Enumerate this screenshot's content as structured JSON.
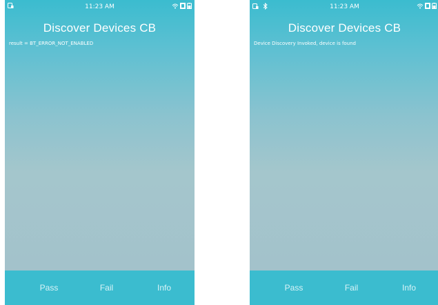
{
  "screens": [
    {
      "status": {
        "time": "11:23 AM",
        "left_icons": [
          "usb-icon"
        ],
        "right_icons": [
          "wifi-icon",
          "signal-icon",
          "battery-icon"
        ]
      },
      "title": "Discover Devices CB",
      "message": "result = BT_ERROR_NOT_ENABLED",
      "buttons": {
        "pass": "Pass",
        "fail": "Fail",
        "info": "Info"
      }
    },
    {
      "status": {
        "time": "11:23 AM",
        "left_icons": [
          "usb-icon",
          "bluetooth-icon"
        ],
        "right_icons": [
          "wifi-icon",
          "signal-icon",
          "battery-icon"
        ]
      },
      "title": "Discover Devices CB",
      "message": "Device Discovery Invoked, device is found",
      "buttons": {
        "pass": "Pass",
        "fail": "Fail",
        "info": "Info"
      }
    }
  ],
  "colors": {
    "accent": "#3bbccf",
    "text": "#ffffff"
  }
}
